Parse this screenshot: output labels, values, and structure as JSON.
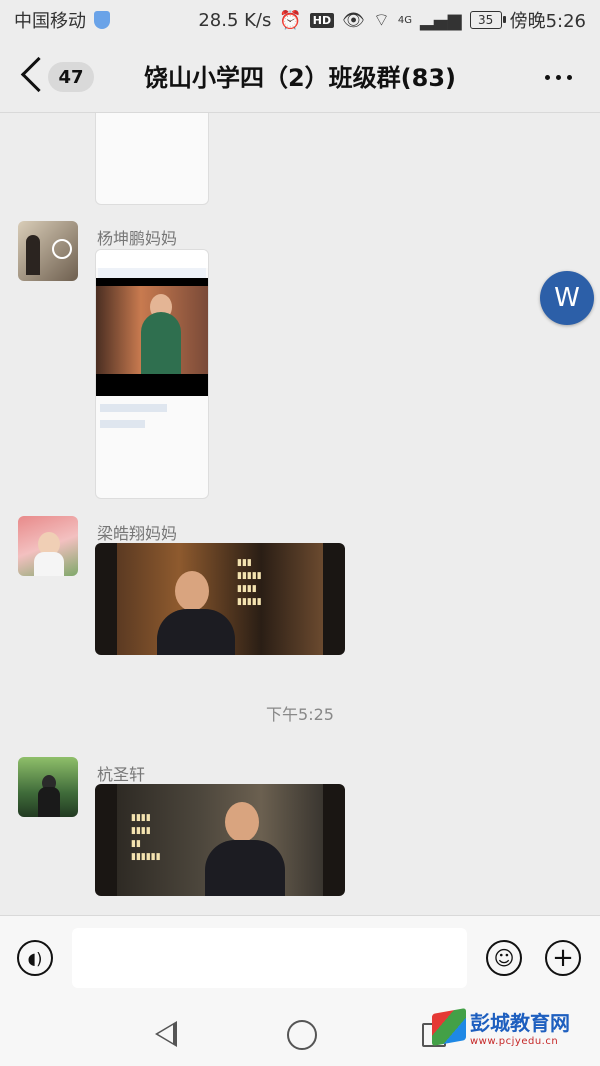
{
  "status_bar": {
    "carrier": "中国移动",
    "speed": "28.5 K/s",
    "hd": "HD",
    "network": "4G",
    "battery": "35",
    "time": "傍晚5:26"
  },
  "header": {
    "unread_count": "47",
    "title": "饶山小学四（2）班级群(83)"
  },
  "messages": [
    {
      "sender": "杨坤鹏妈妈",
      "type": "image"
    },
    {
      "sender": "梁皓翔妈妈",
      "type": "video"
    },
    {
      "sender": "杭圣轩",
      "type": "video"
    }
  ],
  "time_divider": "下午5:25",
  "floating_badge": "W",
  "watermark": {
    "title": "彭城教育网",
    "url": "www.pcjyedu.cn"
  },
  "colors": {
    "background": "#ededed",
    "fab": "#2c5fa8"
  }
}
